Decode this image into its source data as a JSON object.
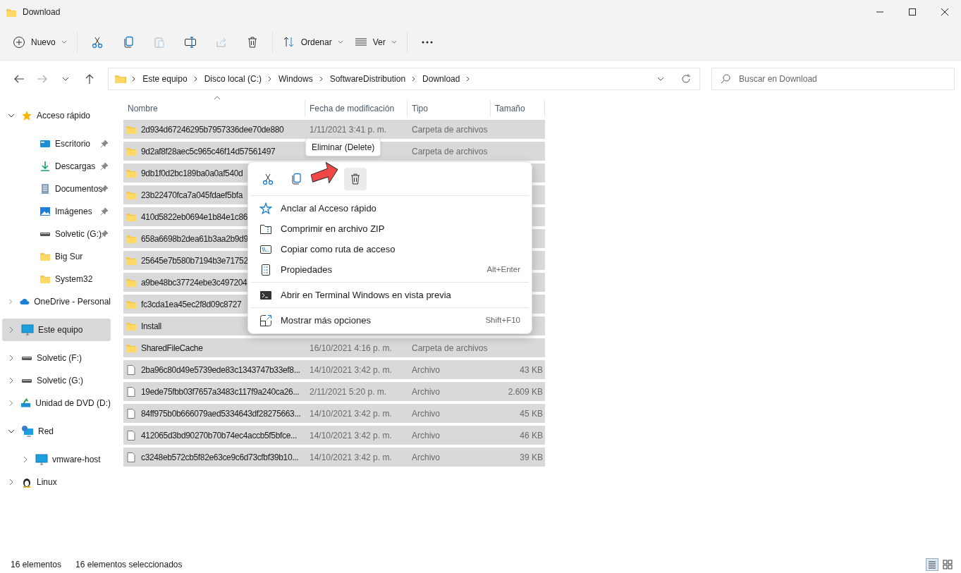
{
  "window": {
    "title": "Download"
  },
  "toolbar": [
    {
      "kind": "new",
      "label": "Nuevo",
      "disabled": false
    },
    {
      "kind": "cut",
      "disabled": false
    },
    {
      "kind": "copy",
      "disabled": false
    },
    {
      "kind": "paste",
      "disabled": true
    },
    {
      "kind": "rename",
      "disabled": false
    },
    {
      "kind": "share",
      "disabled": true
    },
    {
      "kind": "delete",
      "disabled": false
    },
    {
      "kind": "sort",
      "label": "Ordenar",
      "disabled": false
    },
    {
      "kind": "view",
      "label": "Ver",
      "disabled": false
    },
    {
      "kind": "more",
      "disabled": false
    }
  ],
  "address": {
    "path": [
      "Este equipo",
      "Disco local (C:)",
      "Windows",
      "SoftwareDistribution",
      "Download"
    ]
  },
  "search": {
    "placeholder": "Buscar en Download"
  },
  "sidebar": {
    "items": [
      {
        "kind": "star",
        "label": "Acceso rápido",
        "expanded": true,
        "selected": false,
        "children": [
          {
            "kind": "desktop",
            "label": "Escritorio",
            "pinned": true,
            "selected": false
          },
          {
            "kind": "download",
            "label": "Descargas",
            "pinned": true,
            "selected": false
          },
          {
            "kind": "documents",
            "label": "Documentos",
            "pinned": true,
            "selected": false
          },
          {
            "kind": "pictures",
            "label": "Imágenes",
            "pinned": true,
            "selected": false
          },
          {
            "kind": "drive",
            "label": "Solvetic (G:)",
            "pinned": true,
            "selected": false
          },
          {
            "kind": "folder",
            "label": "Big Sur",
            "pinned": false,
            "selected": false
          },
          {
            "kind": "folder",
            "label": "System32",
            "pinned": false,
            "selected": false
          }
        ]
      },
      {
        "kind": "cloud",
        "label": "OneDrive - Personal",
        "expanded": false,
        "selected": false
      },
      {
        "kind": "computer",
        "label": "Este equipo",
        "expanded": false,
        "selected": true
      },
      {
        "kind": "drive",
        "label": "Solvetic (F:)",
        "expanded": false,
        "selected": false
      },
      {
        "kind": "drive",
        "label": "Solvetic (G:)",
        "expanded": false,
        "selected": false
      },
      {
        "kind": "dvd",
        "label": "Unidad de DVD (D:)",
        "expanded": false,
        "selected": false
      },
      {
        "kind": "network",
        "label": "Red",
        "expanded": true,
        "selected": false,
        "children": [
          {
            "kind": "computer",
            "label": "vmware-host",
            "expanded": false,
            "selected": false
          }
        ]
      },
      {
        "kind": "penguin",
        "label": "Linux",
        "expanded": false,
        "selected": false
      }
    ]
  },
  "table": {
    "columns": [
      {
        "label": "Nombre",
        "sorted": true
      },
      {
        "label": "Fecha de modificación",
        "sorted": false
      },
      {
        "label": "Tipo",
        "sorted": false
      },
      {
        "label": "Tamaño",
        "sorted": false
      }
    ],
    "rows": [
      {
        "kind": "folder",
        "name": "2d934d67246295b7957336dee70de880",
        "date": "1/11/2021 3:41 p. m.",
        "type": "Carpeta de archivos",
        "selected": true
      },
      {
        "kind": "folder",
        "name": "9d2af8f28aec5c965c46f14d57561497",
        "type": "Carpeta de archivos",
        "selected": true
      },
      {
        "kind": "folder",
        "name": "9db1f0d2bc189ba0a0af540d",
        "selected": true
      },
      {
        "kind": "folder",
        "name": "23b22470fca7a045fdaef5bfa",
        "selected": true
      },
      {
        "kind": "folder",
        "name": "410d5822eb0694e1b84e1c86",
        "selected": true
      },
      {
        "kind": "folder",
        "name": "658a6698b2dea61b3aa2b9d9",
        "selected": true
      },
      {
        "kind": "folder",
        "name": "25645e7b580b7194b3e71752",
        "selected": true
      },
      {
        "kind": "folder",
        "name": "a9be48bc37724ebe3c497204",
        "selected": true
      },
      {
        "kind": "folder",
        "name": "fc3cda1ea45ec2f8d09c8727",
        "selected": true
      },
      {
        "kind": "folder",
        "name": "Install",
        "selected": true
      },
      {
        "kind": "folder",
        "name": "SharedFileCache",
        "date": "16/10/2021 4:16 p. m.",
        "type": "Carpeta de archivos",
        "selected": true
      },
      {
        "kind": "file",
        "name": "2ba96c80d49e5739ede83c1343747b33ef8...",
        "date": "14/10/2021 3:42 p. m.",
        "type": "Archivo",
        "size": "43 KB",
        "selected": true
      },
      {
        "kind": "file",
        "name": "19ede75fbb03f7657a3483c117f9a240ca26...",
        "date": "2/11/2021 5:20 p. m.",
        "type": "Archivo",
        "size": "2.609 KB",
        "selected": true
      },
      {
        "kind": "file",
        "name": "84ff975b0b666079aed5334643df28275663...",
        "date": "14/10/2021 3:42 p. m.",
        "type": "Archivo",
        "size": "45 KB",
        "selected": true
      },
      {
        "kind": "file",
        "name": "412065d3bd90270b70b74ec4accb5f5bfce...",
        "date": "14/10/2021 3:42 p. m.",
        "type": "Archivo",
        "size": "46 KB",
        "selected": true
      },
      {
        "kind": "file",
        "name": "c3248eb572cb5f82e63ce9c6d73cfbf39b10...",
        "date": "14/10/2021 3:42 p. m.",
        "type": "Archivo",
        "size": "39 KB",
        "selected": true
      }
    ]
  },
  "context_menu": {
    "tooltip": "Eliminar (Delete)",
    "actions": [
      {
        "kind": "cut",
        "hovered": false
      },
      {
        "kind": "copy",
        "hovered": false
      },
      {
        "kind": "delete",
        "hovered": true
      }
    ],
    "sections": [
      {
        "items": [
          {
            "kind": "pin",
            "label": "Anclar al Acceso rápido"
          },
          {
            "kind": "zip",
            "label": "Comprimir en archivo ZIP"
          },
          {
            "kind": "path",
            "label": "Copiar como ruta de acceso"
          },
          {
            "kind": "properties",
            "label": "Propiedades",
            "shortcut": "Alt+Enter"
          }
        ]
      },
      {
        "items": [
          {
            "kind": "terminal",
            "label": "Abrir en Terminal Windows en vista previa"
          }
        ]
      },
      {
        "items": [
          {
            "kind": "more",
            "label": "Mostrar más opciones",
            "shortcut": "Shift+F10"
          }
        ]
      }
    ]
  },
  "status_bar": {
    "count": "16 elementos",
    "selection": "16 elementos seleccionados"
  }
}
